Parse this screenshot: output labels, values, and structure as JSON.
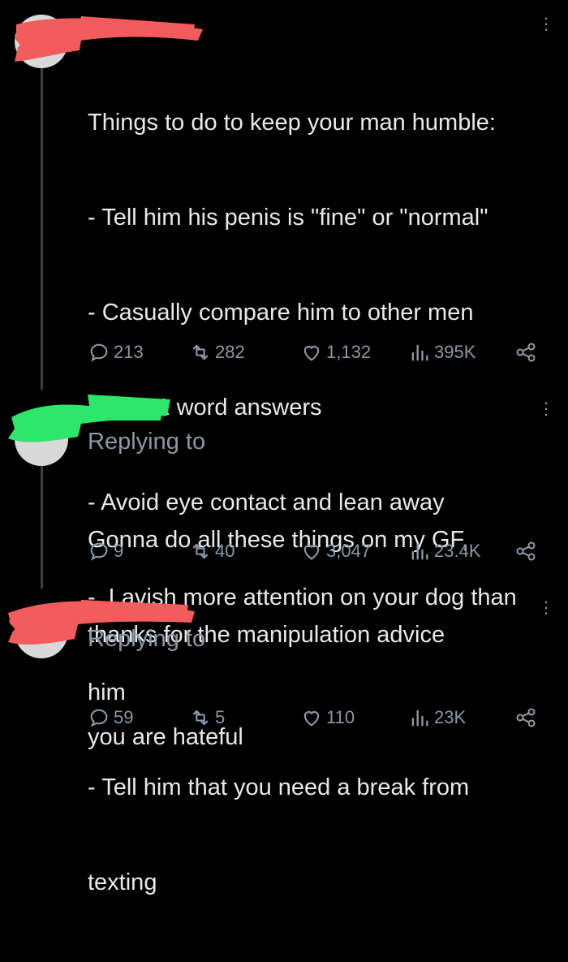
{
  "tweets": [
    {
      "text_lines": [
        "Things to do to keep your man humble:",
        "- Tell him his penis is \"fine\" or \"normal\"",
        "- Casually compare him to other men",
        "- Give 1 word answers",
        "- Avoid eye contact and lean away",
        "-  Lavish more attention on your dog than",
        "him",
        "- Tell him that you need a break from",
        "texting"
      ],
      "replies": "213",
      "retweets": "282",
      "likes": "1,132",
      "views": "395K"
    },
    {
      "replying_to": "Replying to",
      "text_lines": [
        "Gonna do all these things on my GF,",
        "thanks for the manipulation advice"
      ],
      "replies": "9",
      "retweets": "40",
      "likes": "3,047",
      "views": "23.4K"
    },
    {
      "replying_to": "Replying to",
      "text_lines": [
        "you are hateful"
      ],
      "replies": "59",
      "retweets": "5",
      "likes": "110",
      "views": "23K"
    }
  ],
  "colors": {
    "background": "#000000",
    "text": "#e7e9ea",
    "muted": "#8b98a5",
    "redact_red": "#f25c5c",
    "redact_green": "#2ee66b"
  }
}
